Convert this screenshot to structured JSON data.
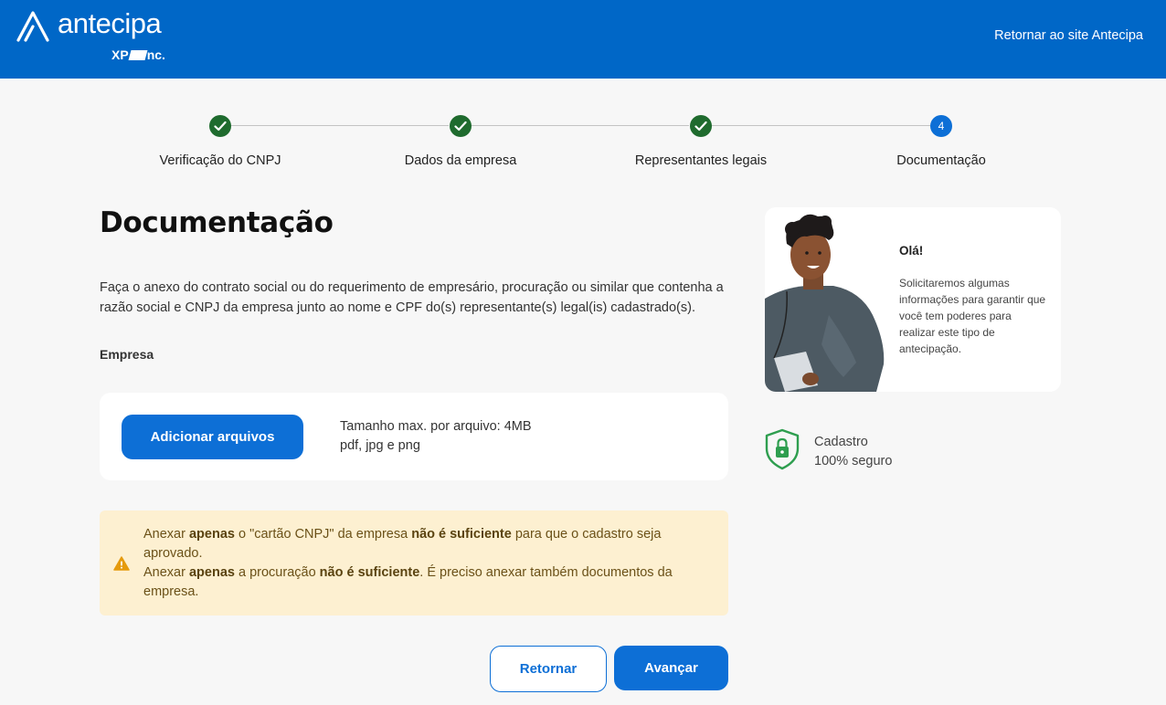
{
  "header": {
    "logo_text": "antecipa",
    "logo_sub_prefix": "XP",
    "logo_sub_suffix": "nc.",
    "back_link": "Retornar ao site Antecipa",
    "background_color": "#0067c7"
  },
  "stepper": {
    "steps": [
      {
        "label": "Verificação do CNPJ",
        "state": "done"
      },
      {
        "label": "Dados da empresa",
        "state": "done"
      },
      {
        "label": "Representantes legais",
        "state": "done"
      },
      {
        "label": "Documentação",
        "state": "active",
        "number": "4"
      }
    ],
    "done_color": "#1f6b2e",
    "active_color": "#0d6fd6"
  },
  "main": {
    "title": "Documentação",
    "description": "Faça o anexo do contrato social ou do requerimento de empresário, procuração ou similar que contenha a razão social e CNPJ da empresa junto ao nome e CPF do(s) representante(s) legal(is) cadastrado(s).",
    "section_label": "Empresa",
    "upload": {
      "button_label": "Adicionar arquivos",
      "max_size": "Tamanho max. por arquivo: 4MB",
      "formats": "pdf, jpg e png"
    },
    "warning": {
      "icon": "warning-triangle-icon",
      "l1_a": "Anexar ",
      "l1_b": "apenas",
      "l1_c": " o \"cartão CNPJ\" da empresa ",
      "l1_d": "não é suficiente",
      "l1_e": " para que o cadastro seja aprovado.",
      "l2_a": "Anexar ",
      "l2_b": "apenas",
      "l2_c": " a procuração ",
      "l2_d": "não é suficiente",
      "l2_e": ". É preciso anexar também documentos da empresa."
    },
    "buttons": {
      "back": "Retornar",
      "next": "Avançar"
    }
  },
  "sidebar": {
    "greeting": "Olá!",
    "message": "Solicitaremos algumas informações para garantir que você tem poderes para realizar este tipo de antecipação.",
    "secure_line1": "Cadastro",
    "secure_line2": "100% seguro",
    "secure_icon": "shield-lock-icon",
    "secure_color": "#2e9e4f"
  }
}
